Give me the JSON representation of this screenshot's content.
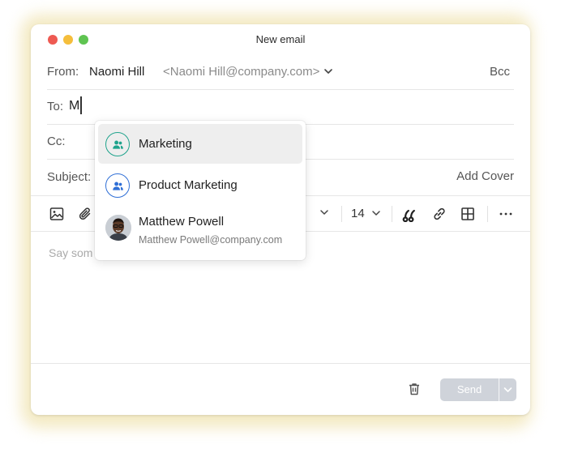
{
  "window": {
    "title": "New email"
  },
  "from": {
    "label": "From:",
    "name": "Naomi Hill",
    "email": "<Naomi Hill@company.com>",
    "bcc_label": "Bcc"
  },
  "to": {
    "label": "To:",
    "value": "M"
  },
  "cc": {
    "label": "Cc:"
  },
  "subject": {
    "label": "Subject:",
    "add_cover_label": "Add Cover"
  },
  "toolbar": {
    "font_size": "14"
  },
  "body": {
    "placeholder": "Say som"
  },
  "footer": {
    "send_label": "Send"
  },
  "suggestions": [
    {
      "label": "Marketing",
      "icon": "group-icon",
      "color": "#1fa38c",
      "selected": true
    },
    {
      "label": "Product Marketing",
      "icon": "group-icon",
      "color": "#2f6fd6",
      "selected": false
    },
    {
      "name": "Matthew Powell",
      "email": "Matthew Powell@company.com",
      "icon": "avatar"
    }
  ]
}
